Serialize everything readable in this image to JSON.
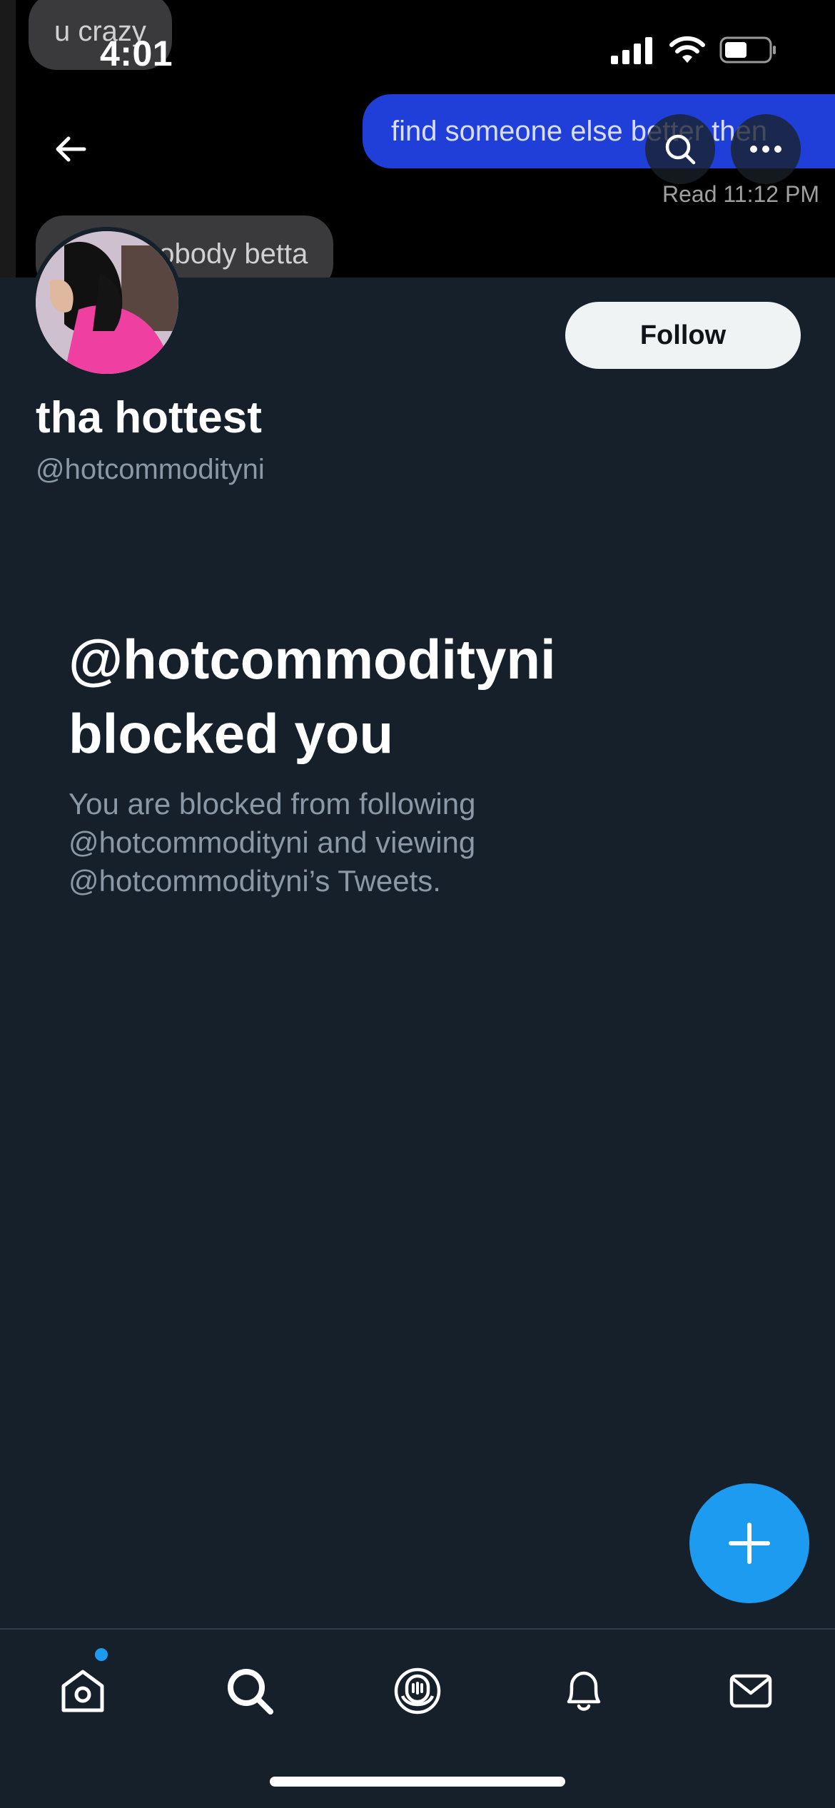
{
  "status_bar": {
    "time": "4:01"
  },
  "banner": {
    "bubble_top": "u crazy",
    "bubble_sent": "find someone else better then",
    "read_receipt": "Read 11:12 PM",
    "bubble_bottom": "nobody betta"
  },
  "header": {
    "back_icon": "arrow-left-icon",
    "search_icon": "search-icon",
    "more_icon": "more-icon"
  },
  "profile": {
    "display_name": "tha hottest",
    "handle": "@hotcommodityni",
    "follow_label": "Follow"
  },
  "blocked": {
    "title_line1": "@hotcommodityni",
    "title_line2": "blocked you",
    "desc_line1": "You are blocked from following",
    "desc_line2": "@hotcommodityni and viewing",
    "desc_line3": "@hotcommodityni’s Tweets."
  },
  "tab_bar": {
    "items": [
      {
        "icon": "home-icon",
        "has_notification_dot": true
      },
      {
        "icon": "search-icon"
      },
      {
        "icon": "spaces-icon"
      },
      {
        "icon": "bell-icon"
      },
      {
        "icon": "mail-icon"
      }
    ]
  },
  "colors": {
    "background": "#15202b",
    "accent": "#1d9bf0",
    "secondary_text": "#8b98a5",
    "follow_button": "#eff3f4"
  }
}
